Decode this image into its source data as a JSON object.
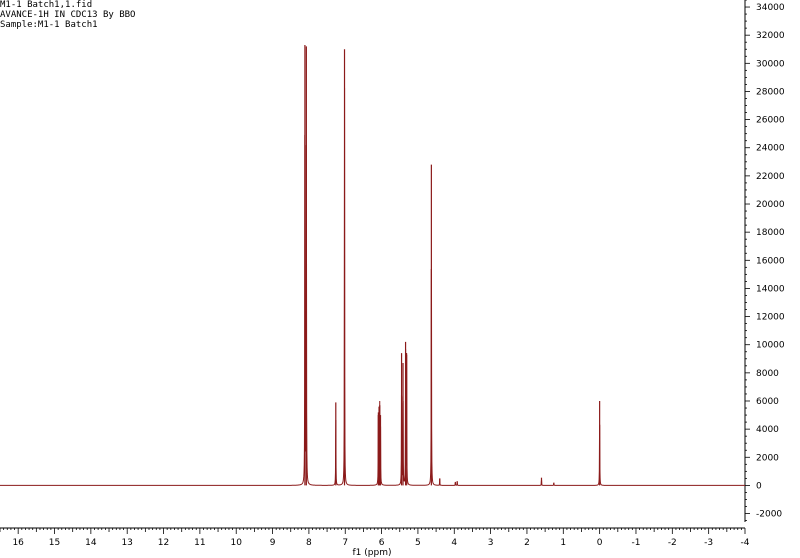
{
  "header": {
    "line1": "M1-1 Batch1,1.fid",
    "line2": "AVANCE-1H IN CDC13 By BBO",
    "line3": "Sample:M1-1 Batch1"
  },
  "colors": {
    "trace": "#8b1a1a",
    "axis": "#000000",
    "background": "#ffffff"
  },
  "chart_data": {
    "type": "line",
    "title": "",
    "xlabel": "f1 (ppm)",
    "ylabel": "",
    "x_reversed": true,
    "xlim": [
      16.5,
      -4.0
    ],
    "ylim": [
      -2600,
      34500
    ],
    "grid": false,
    "y_axis_position": "right",
    "x_ticks": [
      "16",
      "15",
      "14",
      "13",
      "12",
      "11",
      "10",
      "9",
      "8",
      "7",
      "6",
      "5",
      "4",
      "3",
      "2",
      "1",
      "0",
      "-1",
      "-2",
      "-3",
      "-4"
    ],
    "y_ticks": [
      "34000",
      "32000",
      "30000",
      "28000",
      "26000",
      "24000",
      "22000",
      "20000",
      "18000",
      "16000",
      "14000",
      "12000",
      "10000",
      "8000",
      "6000",
      "4000",
      "2000",
      "0",
      "-2000"
    ],
    "series": [
      {
        "peaks": [
          {
            "ppm": 8.11,
            "height": 31300
          },
          {
            "ppm": 8.07,
            "height": 31200
          },
          {
            "ppm": 7.26,
            "height": 5900
          },
          {
            "ppm": 7.02,
            "height": 31000
          },
          {
            "ppm": 6.09,
            "height": 5000
          },
          {
            "ppm": 6.07,
            "height": 5600
          },
          {
            "ppm": 6.05,
            "height": 5700
          },
          {
            "ppm": 6.03,
            "height": 5000
          },
          {
            "ppm": 5.45,
            "height": 9400
          },
          {
            "ppm": 5.41,
            "height": 8700
          },
          {
            "ppm": 5.34,
            "height": 10200
          },
          {
            "ppm": 5.31,
            "height": 9300
          },
          {
            "ppm": 4.63,
            "height": 22800
          },
          {
            "ppm": 4.4,
            "height": 500
          },
          {
            "ppm": 3.97,
            "height": 250
          },
          {
            "ppm": 3.92,
            "height": 300
          },
          {
            "ppm": 1.6,
            "height": 550
          },
          {
            "ppm": 1.26,
            "height": 200
          },
          {
            "ppm": 0.0,
            "height": 6000
          }
        ]
      }
    ]
  }
}
